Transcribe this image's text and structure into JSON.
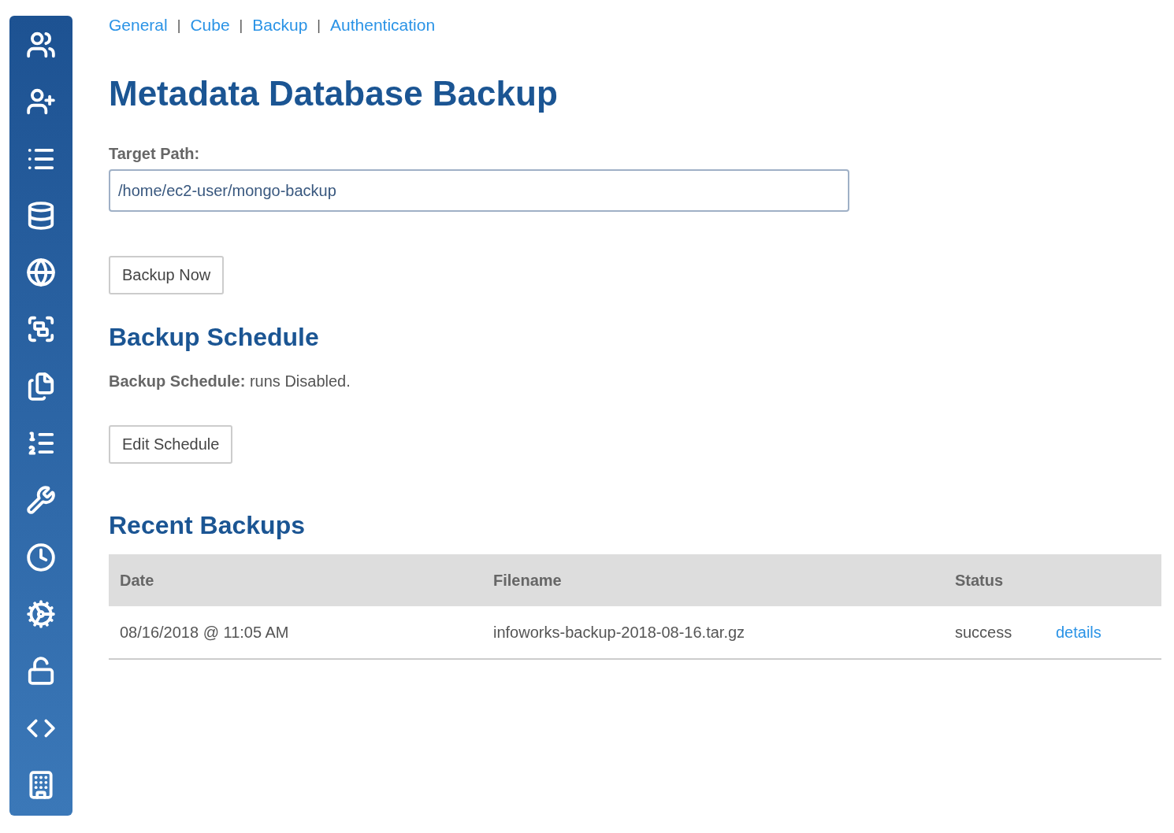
{
  "breadcrumbs": {
    "separator": "|",
    "links": [
      "General",
      "Cube",
      "Backup",
      "Authentication"
    ]
  },
  "title": "Metadata Database Backup",
  "target_path": {
    "label": "Target Path:",
    "value": "/home/ec2-user/mongo-backup"
  },
  "backup_button": "Backup Now",
  "schedule": {
    "heading": "Backup Schedule",
    "text": "**Backup Schedule:** runs Disabled.",
    "button": "Edit Schedule"
  },
  "recent": {
    "heading": "Recent Backups",
    "columns": [
      "Date",
      "Filename",
      "Status"
    ],
    "rows": [
      {
        "date": "08/16/2018 @ 11:05 AM",
        "filename": "infoworks-backup-2018-08-16.tar.gz",
        "status": "success",
        "link": "details"
      }
    ]
  }
}
